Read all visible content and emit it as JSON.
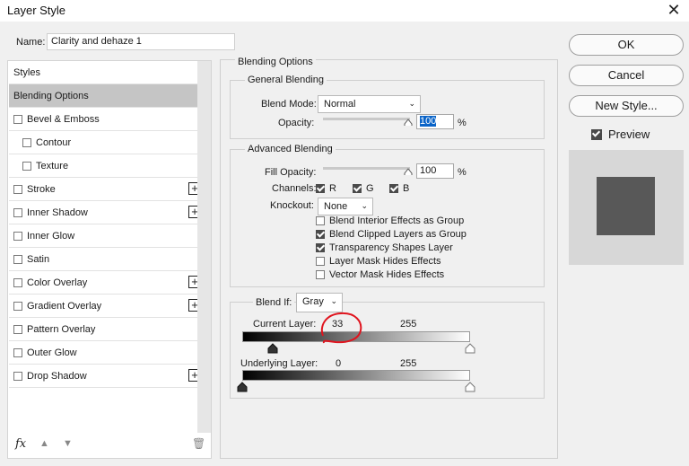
{
  "window": {
    "title": "Layer Style",
    "close_glyph": "✕"
  },
  "name_field": {
    "label": "Name:",
    "value": "Clarity and dehaze 1"
  },
  "styles_panel": {
    "items": [
      {
        "label": "Styles",
        "checkbox": false,
        "selected": false,
        "plus": false,
        "indent": false
      },
      {
        "label": "Blending Options",
        "checkbox": false,
        "selected": true,
        "plus": false,
        "indent": false
      },
      {
        "label": "Bevel & Emboss",
        "checkbox": true,
        "checked": false,
        "plus": false,
        "indent": false
      },
      {
        "label": "Contour",
        "checkbox": true,
        "checked": false,
        "plus": false,
        "indent": true
      },
      {
        "label": "Texture",
        "checkbox": true,
        "checked": false,
        "plus": false,
        "indent": true
      },
      {
        "label": "Stroke",
        "checkbox": true,
        "checked": false,
        "plus": true,
        "indent": false
      },
      {
        "label": "Inner Shadow",
        "checkbox": true,
        "checked": false,
        "plus": true,
        "indent": false
      },
      {
        "label": "Inner Glow",
        "checkbox": true,
        "checked": false,
        "plus": false,
        "indent": false
      },
      {
        "label": "Satin",
        "checkbox": true,
        "checked": false,
        "plus": false,
        "indent": false
      },
      {
        "label": "Color Overlay",
        "checkbox": true,
        "checked": false,
        "plus": true,
        "indent": false
      },
      {
        "label": "Gradient Overlay",
        "checkbox": true,
        "checked": false,
        "plus": true,
        "indent": false
      },
      {
        "label": "Pattern Overlay",
        "checkbox": true,
        "checked": false,
        "plus": false,
        "indent": false
      },
      {
        "label": "Outer Glow",
        "checkbox": true,
        "checked": false,
        "plus": false,
        "indent": false
      },
      {
        "label": "Drop Shadow",
        "checkbox": true,
        "checked": false,
        "plus": true,
        "indent": false
      }
    ],
    "footer": {
      "fx_glyph": "fx",
      "up_glyph": "▲",
      "down_glyph": "▼",
      "trash_glyph": "🗑"
    }
  },
  "blending_options": {
    "title": "Blending Options",
    "general": {
      "title": "General Blending",
      "blend_mode_label": "Blend Mode:",
      "blend_mode_value": "Normal",
      "opacity_label": "Opacity:",
      "opacity_value": "100",
      "opacity_unit": "%"
    },
    "advanced": {
      "title": "Advanced Blending",
      "fill_opacity_label": "Fill Opacity:",
      "fill_opacity_value": "100",
      "fill_unit": "%",
      "channels_label": "Channels:",
      "channels": [
        {
          "label": "R",
          "checked": true
        },
        {
          "label": "G",
          "checked": true
        },
        {
          "label": "B",
          "checked": true
        }
      ],
      "knockout_label": "Knockout:",
      "knockout_value": "None",
      "options": [
        {
          "label": "Blend Interior Effects as Group",
          "checked": false
        },
        {
          "label": "Blend Clipped Layers as Group",
          "checked": true
        },
        {
          "label": "Transparency Shapes Layer",
          "checked": true
        },
        {
          "label": "Layer Mask Hides Effects",
          "checked": false
        },
        {
          "label": "Vector Mask Hides Effects",
          "checked": false
        }
      ]
    },
    "blend_if": {
      "label": "Blend If:",
      "value": "Gray",
      "current_layer_label": "Current Layer:",
      "current_low": "33",
      "current_high": "255",
      "underlying_label": "Underlying Layer:",
      "underlying_low": "0",
      "underlying_high": "255"
    }
  },
  "buttons": {
    "ok": "OK",
    "cancel": "Cancel",
    "new_style": "New Style..."
  },
  "preview": {
    "label": "Preview",
    "checked": true
  },
  "colors": {
    "selected_row": "#c5c5c5",
    "highlight": "#0a64c8",
    "annotation": "#e0141e"
  }
}
